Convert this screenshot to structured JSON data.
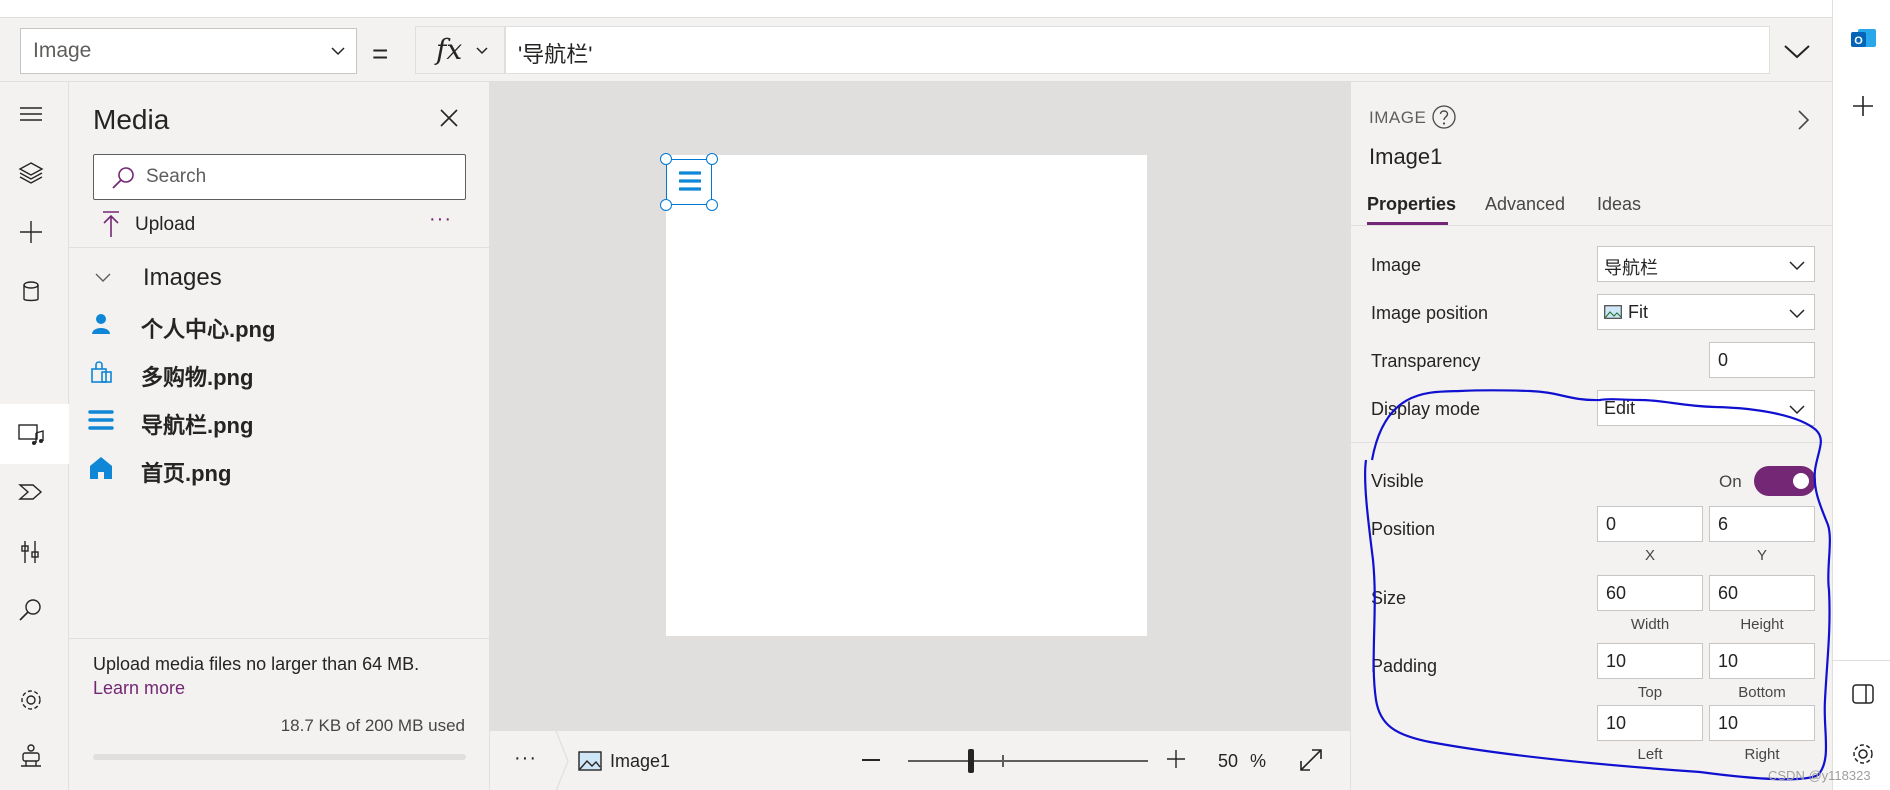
{
  "formula_bar": {
    "property": "Image",
    "equals": "=",
    "fx": "fx",
    "formula": "'导航栏'"
  },
  "media": {
    "title": "Media",
    "search_placeholder": "Search",
    "upload_label": "Upload",
    "more": "···",
    "group_label": "Images",
    "items": [
      {
        "label": "个人中心.png",
        "icon": "person-icon"
      },
      {
        "label": "多购物.png",
        "icon": "shopping-bag-icon"
      },
      {
        "label": "导航栏.png",
        "icon": "hamburger-menu-icon"
      },
      {
        "label": "首页.png",
        "icon": "home-icon"
      }
    ],
    "footer_text": "Upload media files no larger than 64 MB.",
    "learn_more": "Learn more",
    "usage": "18.7 KB of 200 MB used",
    "usage_fraction": 0.0001
  },
  "status_bar": {
    "dots": "···",
    "selected": "Image1",
    "zoom_value": "50",
    "zoom_unit": "%"
  },
  "properties": {
    "type_label": "IMAGE",
    "control_name": "Image1",
    "tabs": [
      "Properties",
      "Advanced",
      "Ideas"
    ],
    "image_label": "Image",
    "image_value": "导航栏",
    "position_mode_label": "Image position",
    "position_mode_value": "Fit",
    "transparency_label": "Transparency",
    "transparency_value": "0",
    "display_mode_label": "Display mode",
    "display_mode_value": "Edit",
    "visible_label": "Visible",
    "visible_state": "On",
    "position_label": "Position",
    "x_value": "0",
    "y_value": "6",
    "x_label": "X",
    "y_label": "Y",
    "size_label": "Size",
    "width_value": "60",
    "height_value": "60",
    "width_label": "Width",
    "height_label": "Height",
    "padding_label": "Padding",
    "top_value": "10",
    "bottom_value": "10",
    "left_value": "10",
    "right_value": "10",
    "top_label": "Top",
    "bottom_label": "Bottom",
    "left_label": "Left",
    "right_label": "Right"
  },
  "colors": {
    "accent": "#742774",
    "selection": "#0078d4",
    "icon_blue": "#0f86d6",
    "annotation": "#1010d0"
  },
  "watermark": "CSDN @y118323"
}
